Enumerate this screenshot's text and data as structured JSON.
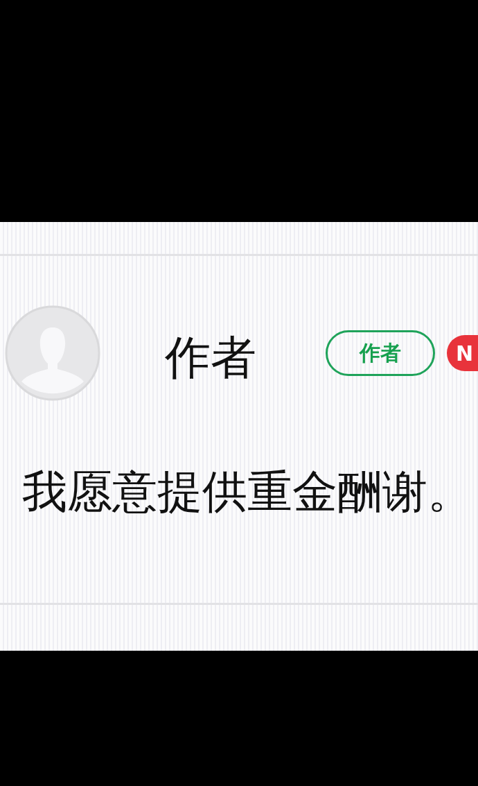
{
  "author_row": {
    "name": "作者",
    "badge": "作者",
    "corner_badge": "N"
  },
  "message": "我愿意提供重金酬谢。"
}
